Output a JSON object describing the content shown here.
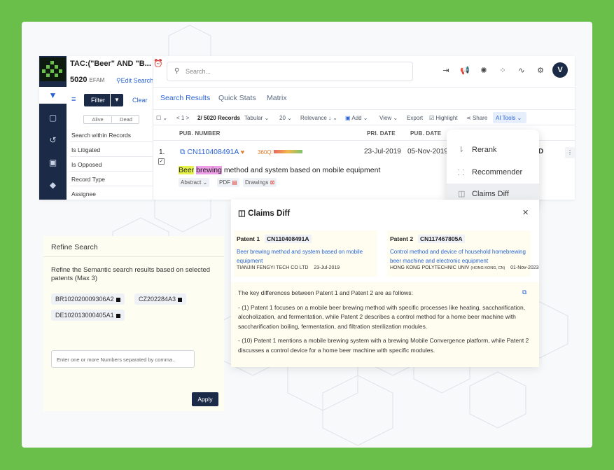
{
  "query": {
    "title": "TAC:(\"Beer\" AND \"B...",
    "count": "5020",
    "count_unit": "EFAM",
    "edit_search": "Edit Search"
  },
  "search": {
    "placeholder": "Search..."
  },
  "user": {
    "avatar_initial": "V"
  },
  "tabs": [
    {
      "label": "Search Results"
    },
    {
      "label": "Quick Stats"
    },
    {
      "label": "Matrix"
    }
  ],
  "filter": {
    "button": "Filter",
    "clear": "Clear",
    "alive": "Alive",
    "dead": "Dead",
    "rows": [
      {
        "label": "Search within Records"
      },
      {
        "label": "Is Litigated"
      },
      {
        "label": "Is Opposed"
      },
      {
        "label": "Record Type"
      },
      {
        "label": "Assignee"
      }
    ]
  },
  "toolbar": {
    "page_prev": "<",
    "page_num": "1",
    "page_next": ">",
    "records": "2/ 5020",
    "records_label": "Records",
    "view_mode": "Tabular",
    "per_page": "20",
    "sort": "Relevance ↓",
    "add": "Add",
    "view": "View",
    "export": "Export",
    "highlight": "Highlight",
    "share": "Share",
    "ai_tools": "AI Tools"
  },
  "columns": {
    "pub_number": "PUB. NUMBER",
    "pri_date": "PRI. DATE",
    "pub_date": "PUB. DATE"
  },
  "result": {
    "index": "1.",
    "pub_number": "CN110408491A",
    "q360_label": "360Q:",
    "pri_date": "23-Jul-2019",
    "pub_date": "05-Nov-2019",
    "title_hl1": "Beer",
    "title_hl2": "brewing",
    "title_rest": "method and system based on mobile equipment",
    "chips": [
      {
        "label": "Abstract"
      },
      {
        "label": "PDF"
      },
      {
        "label": "Drawings"
      }
    ],
    "partial_col": "D"
  },
  "ai_menu": {
    "items": [
      {
        "label": "Rerank"
      },
      {
        "label": "Recommender"
      },
      {
        "label": "Claims Diff"
      }
    ]
  },
  "claims_diff": {
    "title": "Claims Diff",
    "patent1": {
      "label": "Patent 1",
      "number": "CN110408491A",
      "title": "Beer brewing method and system based on mobile equipment",
      "assignee": "TIANJIN FENGYI TECH CO LTD",
      "date": "23-Jul-2019"
    },
    "patent2": {
      "label": "Patent 2",
      "number": "CN117467805A",
      "title": "Control method and device of household homebrewing beer machine and electronic equipment",
      "assignee": "HONG KONG POLYTECHNIC UNIV",
      "assignee_small": "(HONG KONG, CN)",
      "date": "01-Nov-2023"
    },
    "intro": "The key differences between Patent 1 and Patent 2 are as follows:",
    "points": [
      {
        "text": "- (1) Patent 1 focuses on a mobile beer brewing method with specific processes like heating, saccharification, alcoholization, and fermentation, while Patent 2 describes a control method for a home beer machine with saccharification boiling, fermentation, and filtration sterilization modules."
      },
      {
        "text": "- (10) Patent 1 mentions a mobile brewing system with a brewing Mobile Convergence platform, while Patent 2 discusses a control device for a home beer machine with specific modules."
      }
    ]
  },
  "refine": {
    "title": "Refine Search",
    "description": "Refine the Semantic search results based on selected patents (Max 3)",
    "tags": [
      {
        "label": "BR102020009306A2"
      },
      {
        "label": "CZ202284A3"
      },
      {
        "label": "DE102013000405A1"
      }
    ],
    "input_placeholder": "Enter one or more Numbers separated by comma..",
    "apply": "Apply"
  }
}
